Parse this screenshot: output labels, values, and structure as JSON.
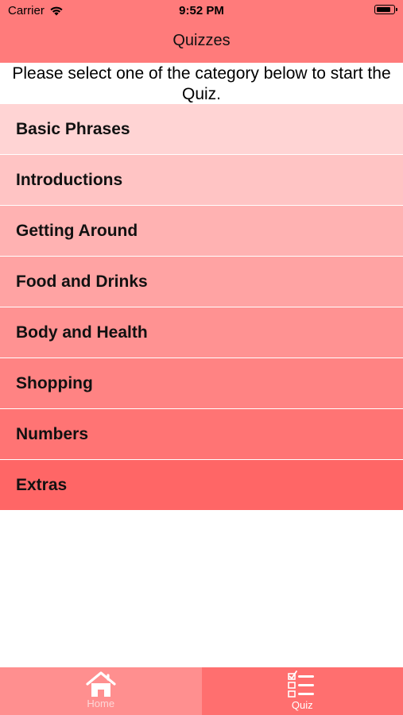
{
  "status_bar": {
    "carrier": "Carrier",
    "time": "9:52 PM"
  },
  "nav": {
    "title": "Quizzes"
  },
  "instruction": "Please select one of the category below to start the Quiz.",
  "categories": [
    {
      "label": "Basic Phrases",
      "color": "#ffd4d4"
    },
    {
      "label": "Introductions",
      "color": "#ffc4c4"
    },
    {
      "label": "Getting Around",
      "color": "#ffb2b2"
    },
    {
      "label": "Food and Drinks",
      "color": "#ffa3a3"
    },
    {
      "label": "Body and Health",
      "color": "#ff9292"
    },
    {
      "label": "Shopping",
      "color": "#ff8383"
    },
    {
      "label": "Numbers",
      "color": "#ff7474"
    },
    {
      "label": "Extras",
      "color": "#ff6666"
    }
  ],
  "tabbar": {
    "home": {
      "label": "Home",
      "icon": "house-icon",
      "selected": false
    },
    "quiz": {
      "label": "Quiz",
      "icon": "checklist-icon",
      "selected": true
    }
  },
  "colors": {
    "header": "#ff7b7b",
    "tab_home_bg": "#ff8f8f",
    "tab_quiz_bg": "#ff6f6f"
  }
}
